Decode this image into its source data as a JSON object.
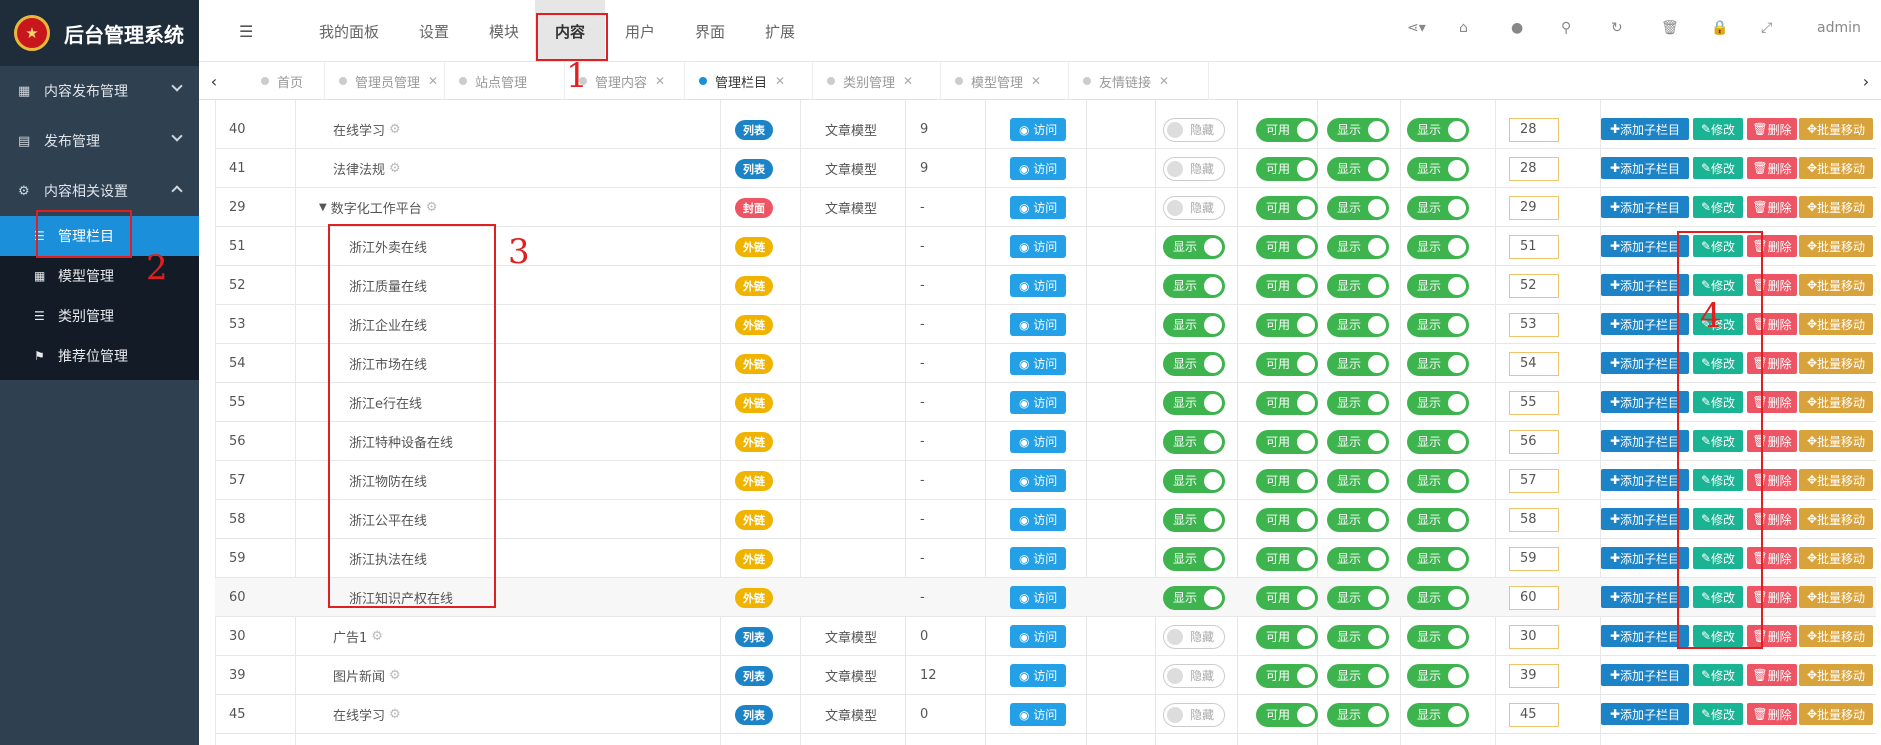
{
  "app": {
    "title": "后台管理系统"
  },
  "sidebar": {
    "groups": [
      {
        "label": "内容发布管理"
      },
      {
        "label": "发布管理"
      },
      {
        "label": "内容相关设置"
      }
    ],
    "items": [
      {
        "label": "管理栏目"
      },
      {
        "label": "模型管理"
      },
      {
        "label": "类别管理"
      },
      {
        "label": "推荐位管理"
      }
    ]
  },
  "topnav": {
    "items": [
      {
        "label": "我的面板"
      },
      {
        "label": "设置"
      },
      {
        "label": "模块"
      },
      {
        "label": "内容"
      },
      {
        "label": "用户"
      },
      {
        "label": "界面"
      },
      {
        "label": "扩展"
      }
    ],
    "user": "admin"
  },
  "tabs": [
    {
      "label": "首页"
    },
    {
      "label": "管理员管理"
    },
    {
      "label": "站点管理"
    },
    {
      "label": "管理内容"
    },
    {
      "label": "管理栏目"
    },
    {
      "label": "类别管理"
    },
    {
      "label": "模型管理"
    },
    {
      "label": "友情链接"
    }
  ],
  "labels": {
    "visit": "访问",
    "hidden": "隐藏",
    "show": "显示",
    "usable": "可用",
    "add_child": "添加子栏目",
    "edit": "修改",
    "delete": "删除",
    "batch_move": "批量移动"
  },
  "rows": [
    {
      "id": "40",
      "name": "在线学习",
      "type": "列表",
      "model": "文章模型",
      "count": "9",
      "nav": "隐藏",
      "sort": "28"
    },
    {
      "id": "41",
      "name": "法律法规",
      "type": "列表",
      "model": "文章模型",
      "count": "9",
      "nav": "隐藏",
      "sort": "28"
    },
    {
      "id": "29",
      "name": "数字化工作平台",
      "type": "封面",
      "model": "文章模型",
      "count": "-",
      "nav": "隐藏",
      "sort": "29"
    },
    {
      "id": "51",
      "name": "浙江外卖在线",
      "type": "外链",
      "model": "",
      "count": "-",
      "nav": "显示",
      "sort": "51"
    },
    {
      "id": "52",
      "name": "浙江质量在线",
      "type": "外链",
      "model": "",
      "count": "-",
      "nav": "显示",
      "sort": "52"
    },
    {
      "id": "53",
      "name": "浙江企业在线",
      "type": "外链",
      "model": "",
      "count": "-",
      "nav": "显示",
      "sort": "53"
    },
    {
      "id": "54",
      "name": "浙江市场在线",
      "type": "外链",
      "model": "",
      "count": "-",
      "nav": "显示",
      "sort": "54"
    },
    {
      "id": "55",
      "name": "浙江e行在线",
      "type": "外链",
      "model": "",
      "count": "-",
      "nav": "显示",
      "sort": "55"
    },
    {
      "id": "56",
      "name": "浙江特种设备在线",
      "type": "外链",
      "model": "",
      "count": "-",
      "nav": "显示",
      "sort": "56"
    },
    {
      "id": "57",
      "name": "浙江物防在线",
      "type": "外链",
      "model": "",
      "count": "-",
      "nav": "显示",
      "sort": "57"
    },
    {
      "id": "58",
      "name": "浙江公平在线",
      "type": "外链",
      "model": "",
      "count": "-",
      "nav": "显示",
      "sort": "58"
    },
    {
      "id": "59",
      "name": "浙江执法在线",
      "type": "外链",
      "model": "",
      "count": "-",
      "nav": "显示",
      "sort": "59"
    },
    {
      "id": "60",
      "name": "浙江知识产权在线",
      "type": "外链",
      "model": "",
      "count": "-",
      "nav": "显示",
      "sort": "60"
    },
    {
      "id": "30",
      "name": "广告1",
      "type": "列表",
      "model": "文章模型",
      "count": "0",
      "nav": "隐藏",
      "sort": "30"
    },
    {
      "id": "39",
      "name": "图片新闻",
      "type": "列表",
      "model": "文章模型",
      "count": "12",
      "nav": "隐藏",
      "sort": "39"
    },
    {
      "id": "45",
      "name": "在线学习",
      "type": "列表",
      "model": "文章模型",
      "count": "0",
      "nav": "隐藏",
      "sort": "45"
    }
  ],
  "annotations": [
    "1",
    "2",
    "3",
    "4"
  ],
  "colors": {
    "sidebar_bg": "#2f4050",
    "active_blue": "#1b8fd9",
    "green": "#3eb44f",
    "annotation": "#e02020"
  }
}
